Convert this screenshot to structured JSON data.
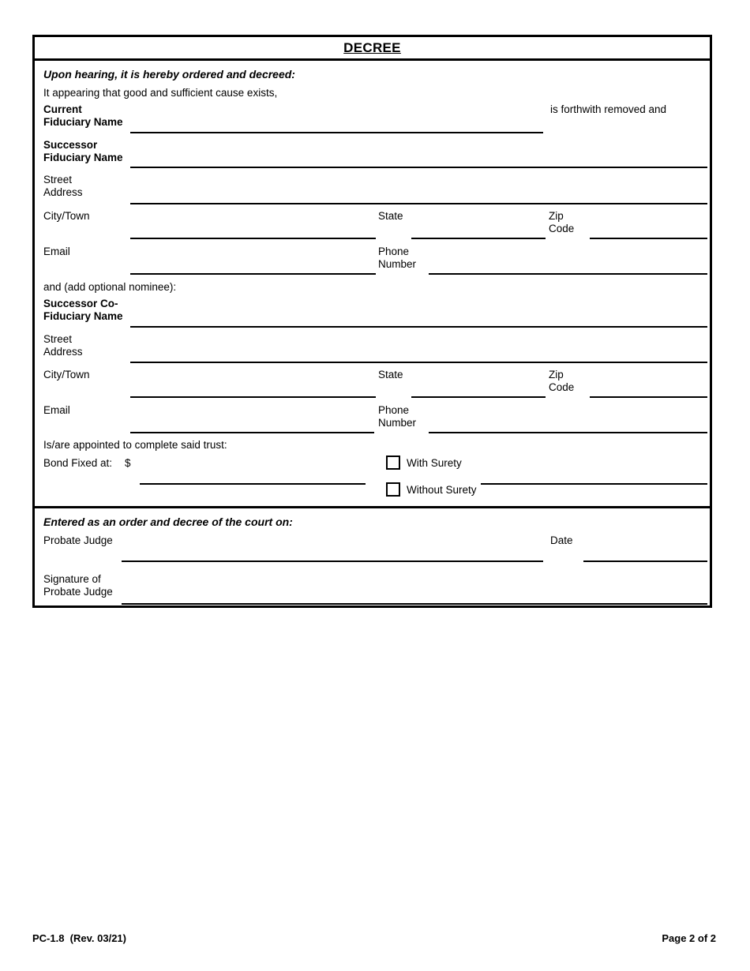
{
  "document": {
    "title": "DECREE",
    "form_id": "PC-1.8",
    "revision": "(Rev. 03/21)",
    "footer_left": "PC-1.8  (Rev. 03/21)",
    "footer_right": "Page 2 of 2"
  },
  "decree": {
    "heading": "Upon hearing, it is hereby ordered and decreed:",
    "intro": "It appearing that good and sufficient cause exists,",
    "removed_note": "is forthwith removed and",
    "nominee_note_plain": "and ",
    "nominee_note_italic": "(add optional nominee)",
    "nominee_note_tail": ":",
    "appointed_note": "Is/are appointed to complete said trust:",
    "current_fiduciary_label_line1": "Current",
    "current_fiduciary_label_line2": "Fiduciary Name",
    "current_fiduciary_value": "",
    "successor_fiduciary_label_line1": "Successor",
    "successor_fiduciary_label_line2": "Fiduciary Name",
    "successor_fiduciary_value": "",
    "successor_co_fiduciary_label_line1": "Successor Co-",
    "successor_co_fiduciary_label_line2": "Fiduciary Name",
    "successor_co_fiduciary_value": ""
  },
  "address_labels": {
    "street_line1": "Street",
    "street_line2": "Address",
    "city_town": "City/Town",
    "state": "State",
    "zip_line1": "Zip",
    "zip_line2": "Code",
    "email": "Email",
    "phone_line1": "Phone",
    "phone_line2": "Number"
  },
  "successor_address": {
    "street": "",
    "city_town": "",
    "state": "",
    "zip": "",
    "email": "",
    "phone": ""
  },
  "co_fiduciary_address": {
    "street": "",
    "city_town": "",
    "state": "",
    "zip": "",
    "email": "",
    "phone": ""
  },
  "bond": {
    "label": "Bond Fixed at:",
    "currency_symbol": "$",
    "amount": "",
    "with_surety_label": "With Surety",
    "without_surety_label": "Without Surety",
    "with_surety_checked": false,
    "without_surety_checked": false,
    "surety_name": ""
  },
  "entered": {
    "heading": "Entered as an order and decree of the court on:",
    "probate_judge_label": "Probate Judge",
    "probate_judge_value": "",
    "date_label": "Date",
    "date_value": "",
    "signature_label_line1": "Signature of",
    "signature_label_line2": "Probate Judge",
    "signature_value": ""
  }
}
